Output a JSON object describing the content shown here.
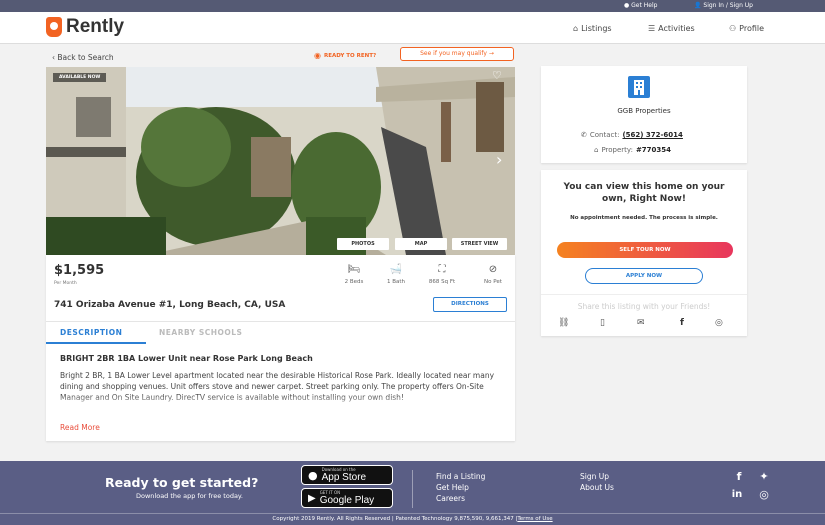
{
  "topbar": {
    "help": "Get Help",
    "sign": "Sign In / Sign Up"
  },
  "nav": {
    "logo": "Rently",
    "listings": "Listings",
    "activities": "Activities",
    "profile": "Profile"
  },
  "back": "Back to Search",
  "ready_badge": "READY TO RENT?",
  "qualify_button": "See if you may qualify",
  "photo_badge": "AVAILABLE NOW",
  "photo_buttons": {
    "photos": "PHOTOS",
    "map": "MAP",
    "street": "STREET VIEW"
  },
  "price": {
    "amount": "$1,595",
    "per": "Per Month"
  },
  "features": [
    {
      "icon": "bed-icon",
      "label": "2 Beds"
    },
    {
      "icon": "bath-icon",
      "label": "1 Bath"
    },
    {
      "icon": "area-icon",
      "label": "868 Sq Ft"
    },
    {
      "icon": "no-pets-icon",
      "label": "No Pet"
    }
  ],
  "address": "741 Orizaba Avenue #1, Long Beach, CA, USA",
  "directions": "DIRECTIONS",
  "tabs": {
    "description": "DESCRIPTION",
    "schools": "NEARBY SCHOOLS"
  },
  "listing": {
    "headline": "BRIGHT 2BR 1BA Lower Unit near Rose Park Long Beach",
    "body": "Bright 2 BR, 1 BA Lower Level apartment located near the desirable Historical Rose Park. Ideally located near many dining and shopping venues. Unit offers stove and newer carpet. Street parking only. The property offers On-Site Manager and On Site Laundry. DirecTV service is available without installing your own dish!",
    "read_more": "Read More"
  },
  "agent": {
    "name": "GGB Properties",
    "contact_label": "Contact:",
    "phone": "(562) 372-6014",
    "property_label": "Property:",
    "property_id": "#770354"
  },
  "tour": {
    "heading": "You can view this home on your own, Right Now!",
    "sub": "No appointment needed. The process is simple.",
    "self_tour": "SELF TOUR NOW",
    "apply": "APPLY NOW",
    "share": "Share this listing with your Friends!"
  },
  "footer": {
    "heading": "Ready to get started?",
    "sub": "Download the app for free today.",
    "appstore_small": "Download on the",
    "appstore": "App Store",
    "gplay_small": "GET IT ON",
    "gplay": "Google Play",
    "links_col1": [
      "Find a Listing",
      "Get Help",
      "Careers"
    ],
    "links_col2": [
      "Sign Up",
      "About Us"
    ],
    "copyright": "Copyright 2019 Rently. All Rights Reserved | Patented Technology 9,875,590, 9,661,347 |",
    "terms": "Terms of Use"
  },
  "colors": {
    "brand": "#f26322",
    "footer": "#5a5e85",
    "accent_blue": "#2b7fd4"
  }
}
